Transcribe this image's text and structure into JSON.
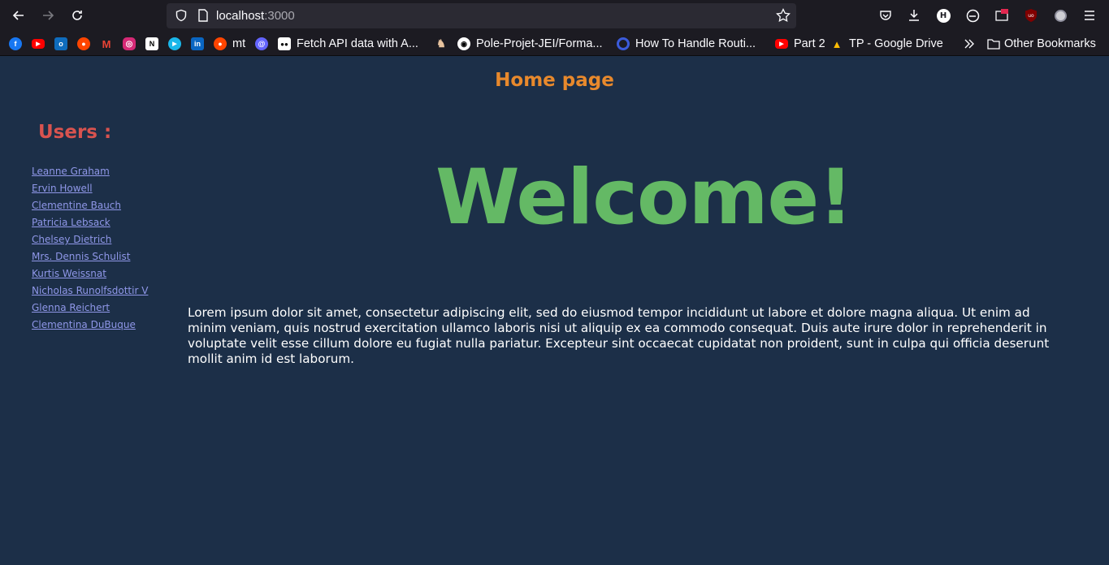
{
  "browser": {
    "url_host": "localhost",
    "url_port": ":3000",
    "bookmarks": [
      {
        "label": "mt",
        "color": "#ff4500",
        "glyph": "●"
      },
      {
        "label": "Fetch API data with A...",
        "color": "#000000",
        "glyph": "●●"
      },
      {
        "label": "Pole-Projet-JEI/Forma...",
        "color": "#333333",
        "glyph": "◉"
      },
      {
        "label": "How To Handle Routi...",
        "color": "#3b5bdb",
        "glyph": "◔"
      },
      {
        "label": "Part 2",
        "color": "#ff0000",
        "glyph": "▶"
      },
      {
        "label": "TP - Google Drive",
        "color": "#1fa463",
        "glyph": "▲"
      }
    ],
    "other_bookmarks": "Other Bookmarks",
    "icon_bookmarks": [
      {
        "name": "facebook-icon",
        "color": "#1877f2",
        "glyph": "f"
      },
      {
        "name": "youtube-icon",
        "color": "#ff0000",
        "glyph": "▶"
      },
      {
        "name": "outlook-icon",
        "color": "#0f6cbd",
        "glyph": "o"
      },
      {
        "name": "reddit-icon",
        "color": "#ff4500",
        "glyph": "●"
      },
      {
        "name": "gmail-icon",
        "color": "#ea4335",
        "glyph": "M"
      },
      {
        "name": "instagram-icon",
        "color": "#d62976",
        "glyph": "◎"
      },
      {
        "name": "notion-icon",
        "color": "#ffffff",
        "glyph": "N"
      },
      {
        "name": "play-icon",
        "color": "#1ab7ea",
        "glyph": "▶"
      },
      {
        "name": "linkedin-icon",
        "color": "#0a66c2",
        "glyph": "in"
      }
    ]
  },
  "page": {
    "title": "Home page",
    "users_heading": "Users :",
    "users": [
      "Leanne Graham",
      "Ervin Howell",
      "Clementine Bauch",
      "Patricia Lebsack",
      "Chelsey Dietrich",
      "Mrs. Dennis Schulist",
      "Kurtis Weissnat",
      "Nicholas Runolfsdottir V",
      "Glenna Reichert",
      "Clementina DuBuque"
    ],
    "welcome": "Welcome!",
    "lorem": "Lorem ipsum dolor sit amet, consectetur adipiscing elit, sed do eiusmod tempor incididunt ut labore et dolore magna aliqua. Ut enim ad minim veniam, quis nostrud exercitation ullamco laboris nisi ut aliquip ex ea commodo consequat. Duis aute irure dolor in reprehenderit in voluptate velit esse cillum dolore eu fugiat nulla pariatur. Excepteur sint occaecat cupidatat non proident, sunt in culpa qui officia deserunt mollit anim id est laborum."
  },
  "colors": {
    "page_bg": "#1c2f48",
    "title": "#e8892c",
    "users_heading": "#d9534f",
    "link": "#8f97e8",
    "welcome": "#64b965"
  }
}
